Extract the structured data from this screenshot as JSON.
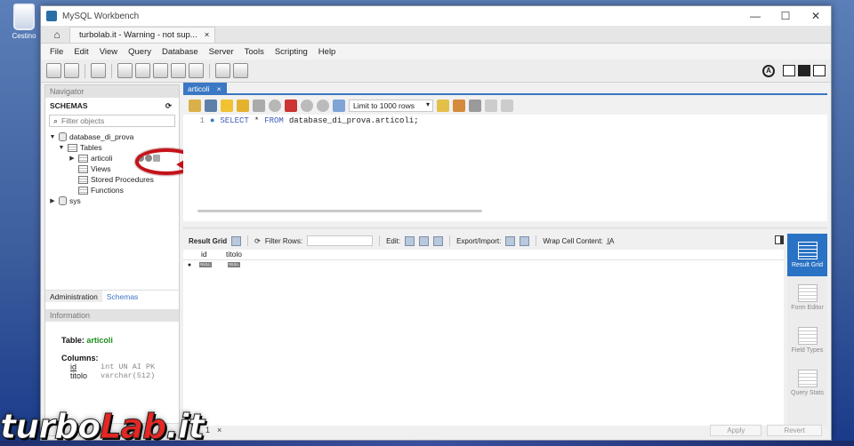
{
  "desktop": {
    "recycle_bin_label": "Cestino"
  },
  "window": {
    "title": "MySQL Workbench",
    "controls": {
      "minimize": "—",
      "maximize": "☐",
      "close": "✕"
    }
  },
  "tabs": {
    "home_icon": "house-icon",
    "connection_tab": "turbolab.it - Warning - not sup...",
    "close": "×"
  },
  "menu": [
    "File",
    "Edit",
    "View",
    "Query",
    "Database",
    "Server",
    "Tools",
    "Scripting",
    "Help"
  ],
  "navigator": {
    "header": "Navigator",
    "schemas_label": "SCHEMAS",
    "filter_placeholder": "Filter objects",
    "tree": {
      "db": "database_di_prova",
      "tables_label": "Tables",
      "table": "articoli",
      "views": "Views",
      "stored_procedures": "Stored Procedures",
      "functions": "Functions",
      "sys": "sys"
    },
    "bottom_tabs": {
      "administration": "Administration",
      "schemas": "Schemas"
    },
    "info_header": "Information"
  },
  "information": {
    "table_label": "Table:",
    "table_name": "articoli",
    "columns_label": "Columns:",
    "columns": [
      {
        "name": "id",
        "type": "int UN AI PK"
      },
      {
        "name": "titolo",
        "type": "varchar(512)"
      }
    ]
  },
  "editor": {
    "tab_label": "articoli",
    "tab_close": "×",
    "limit_select": "Limit to 1000 rows",
    "line_number": "1",
    "sql_kw_select": "SELECT",
    "sql_star": "*",
    "sql_kw_from": "FROM",
    "sql_rest": "database_di_prova.articoli;"
  },
  "result": {
    "grid_label": "Result Grid",
    "filter_rows_label": "Filter Rows:",
    "edit_label": "Edit:",
    "export_label": "Export/Import:",
    "wrap_label": "Wrap Cell Content:",
    "columns": [
      "id",
      "titolo"
    ],
    "row_marker": "●",
    "null_badge": "NULL"
  },
  "side_panel": [
    {
      "label": "Result Grid",
      "active": true
    },
    {
      "label": "Form Editor",
      "active": false
    },
    {
      "label": "Field Types",
      "active": false
    },
    {
      "label": "Query Stats",
      "active": false
    }
  ],
  "status": {
    "tab_number": "1",
    "tab_close": "×",
    "apply": "Apply",
    "revert": "Revert"
  },
  "watermark": {
    "part1": "turbo",
    "part2": "Lab",
    "part3": ".it"
  },
  "colors": {
    "accent": "#3a77c4",
    "highlight_ring": "#c41219",
    "info_value": "#1d8c1d"
  }
}
